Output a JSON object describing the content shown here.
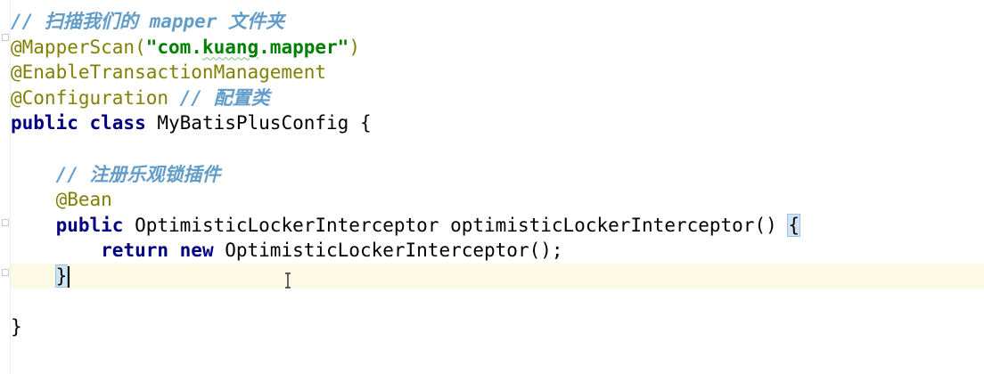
{
  "editor": {
    "lines": [
      {
        "tokens": [
          {
            "type": "comment",
            "text": "// 扫描我们的 mapper 文件夹"
          }
        ]
      },
      {
        "tokens": [
          {
            "type": "annotation",
            "text": "@MapperScan("
          },
          {
            "type": "string",
            "text": "\"com."
          },
          {
            "type": "string-squiggle",
            "text": "kuang"
          },
          {
            "type": "string",
            "text": ".mapper\""
          },
          {
            "type": "annotation",
            "text": ")"
          }
        ]
      },
      {
        "tokens": [
          {
            "type": "annotation",
            "text": "@EnableTransactionManagement"
          }
        ]
      },
      {
        "tokens": [
          {
            "type": "annotation",
            "text": "@Configuration "
          },
          {
            "type": "comment",
            "text": "// 配置类"
          }
        ]
      },
      {
        "tokens": [
          {
            "type": "keyword",
            "text": "public class "
          },
          {
            "type": "plain",
            "text": "MyBatisPlusConfig {"
          }
        ]
      },
      {
        "tokens": []
      },
      {
        "tokens": [
          {
            "type": "plain",
            "text": "    "
          },
          {
            "type": "comment",
            "text": "// 注册乐观锁插件"
          }
        ]
      },
      {
        "tokens": [
          {
            "type": "plain",
            "text": "    "
          },
          {
            "type": "annotation",
            "text": "@Bean"
          }
        ]
      },
      {
        "tokens": [
          {
            "type": "plain",
            "text": "    "
          },
          {
            "type": "keyword",
            "text": "public "
          },
          {
            "type": "plain",
            "text": "OptimisticLockerInterceptor optimisticLockerInterceptor() "
          },
          {
            "type": "brace-match",
            "text": "{"
          }
        ]
      },
      {
        "tokens": [
          {
            "type": "plain",
            "text": "        "
          },
          {
            "type": "keyword",
            "text": "return new "
          },
          {
            "type": "plain",
            "text": "OptimisticLockerInterceptor();"
          }
        ]
      },
      {
        "tokens": [
          {
            "type": "plain",
            "text": "    "
          },
          {
            "type": "brace-match",
            "text": "}"
          },
          {
            "type": "caret",
            "text": ""
          }
        ],
        "current": true
      },
      {
        "tokens": []
      },
      {
        "tokens": [
          {
            "type": "plain",
            "text": "}"
          }
        ]
      }
    ]
  },
  "colors": {
    "comment": "#629cc9",
    "annotation": "#808000",
    "keyword": "#000080",
    "string": "#008000",
    "current_line": "#fcfae5",
    "brace_match": "#cfe3f5"
  }
}
